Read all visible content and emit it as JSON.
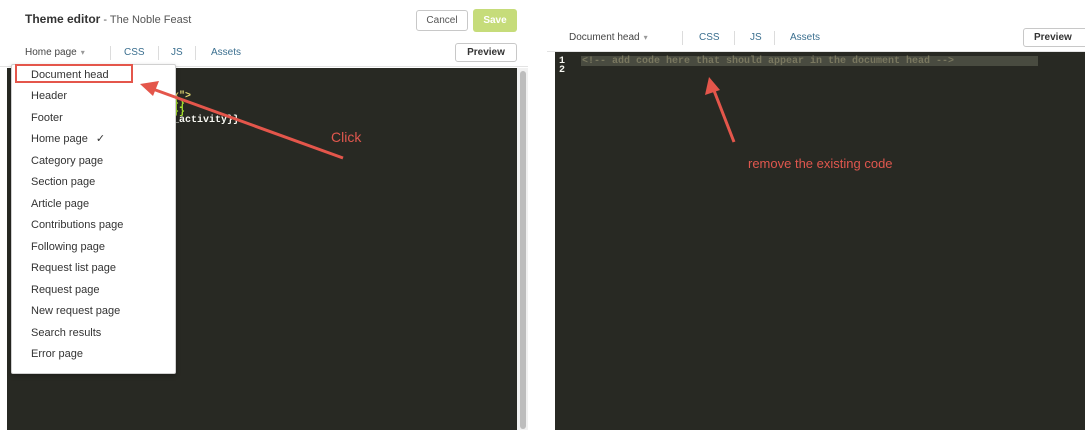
{
  "left": {
    "title": "Theme editor",
    "subtitle": " - The Noble Feast",
    "cancel_label": "Cancel",
    "save_label": "Save",
    "tabs": {
      "page_select": "Home page",
      "css": "CSS",
      "js": "JS",
      "assets": "Assets",
      "preview": "Preview"
    },
    "code_fragments": [
      "x\">",
      "}}",
      "}}",
      "_activity}}"
    ],
    "dropdown": {
      "selected": "Home page",
      "items": [
        "Document head",
        "Header",
        "Footer",
        "Home page",
        "Category page",
        "Section page",
        "Article page",
        "Contributions page",
        "Following page",
        "Request list page",
        "Request page",
        "New request page",
        "Search results",
        "Error page"
      ],
      "check_glyph": "✓",
      "highlighted": "Document head"
    },
    "annotation": "Click"
  },
  "right": {
    "tabs": {
      "page_select": "Document head",
      "css": "CSS",
      "js": "JS",
      "assets": "Assets",
      "preview": "Preview"
    },
    "line_numbers": [
      "1",
      "2"
    ],
    "code_line_1": "<!-- add code here that should appear in the document head -->",
    "annotation": "remove the existing code"
  },
  "icons": {
    "caret": "▾",
    "check": "✓"
  },
  "colors": {
    "editor_bg": "#282923",
    "annotation_red": "#e0574e",
    "save_button": "#c6dc7a",
    "tab_link": "#3b6f8f"
  }
}
